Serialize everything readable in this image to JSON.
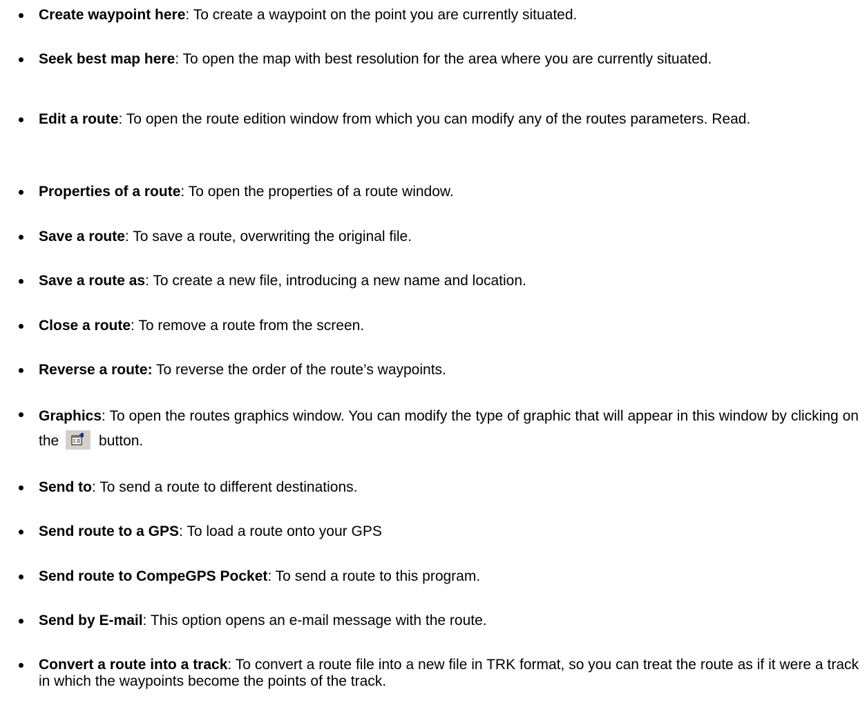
{
  "items": [
    {
      "term": "Create waypoint here",
      "text": ": To create a waypoint on the point you are currently situated."
    },
    {
      "term": "Seek best map here",
      "text": ": To open the map with best resolution for the area where you are currently situated."
    },
    {
      "term": "Edit a route",
      "text": ": To open the route edition window from which you can modify any of the routes parameters. Read."
    },
    {
      "term": "Properties of a route",
      "text": ": To open the properties of a route window."
    },
    {
      "term": "Save a route",
      "text": ": To save a route, overwriting the original file."
    },
    {
      "term": "Save a route as",
      "text": ": To create a new file, introducing a new name and location."
    },
    {
      "term": "Close a route",
      "text": ": To remove a route from the screen."
    },
    {
      "term": "Reverse a route:",
      "text": " To reverse the order of the route’s waypoints."
    },
    {
      "term": "Graphics",
      "text": ": To open the routes graphics window. You can modify the type of graphic that will appear in this window by clicking on the",
      "text_after": " button.",
      "icon": "graph-properties-icon"
    },
    {
      "term": "Send to",
      "text": ": To send a route to different destinations."
    },
    {
      "term": "Send route to a GPS",
      "text": ": To load a route onto your GPS"
    },
    {
      "term": "Send route to CompeGPS Pocket",
      "text": ": To send a route to this program."
    },
    {
      "term": "Send by E-mail",
      "text": ": This option opens an e-mail message with the route."
    },
    {
      "term": "Convert a route into a track",
      "text": ": To convert a route file into a new file in TRK format, so you can treat the route as if it were a track in which the waypoints become the points of the track."
    }
  ],
  "colors": {
    "text": "#000000",
    "background": "#ffffff",
    "icon_button_bg": "#d4d0c8",
    "icon_accent": "#1a2a9a"
  }
}
